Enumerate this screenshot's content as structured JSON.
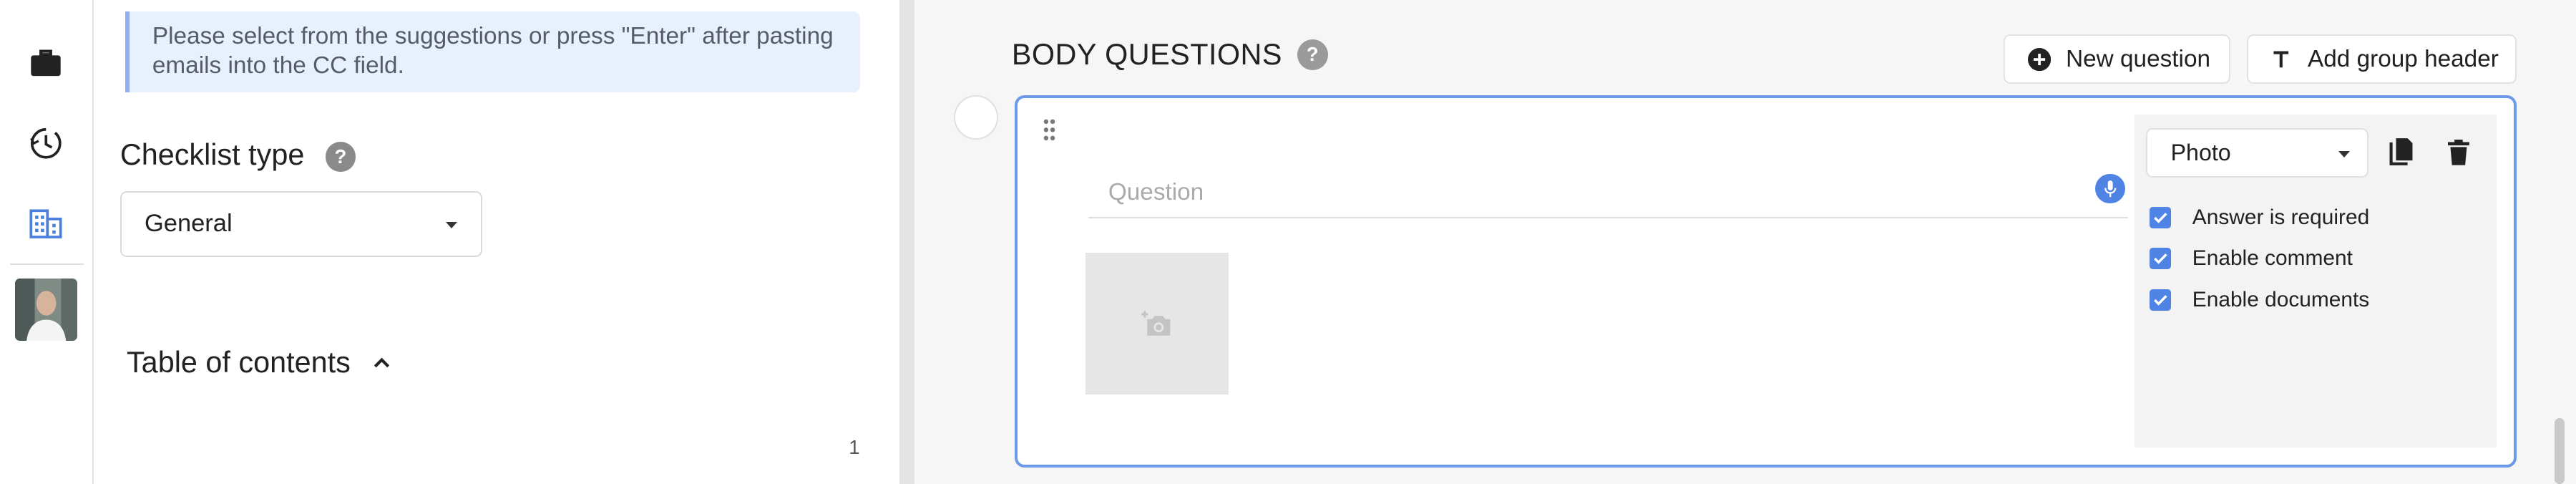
{
  "nav": {
    "icons": [
      "briefcase-icon",
      "history-icon",
      "building-icon"
    ],
    "accent_color": "#4a7fe0"
  },
  "settings": {
    "info_text": "Please select from the suggestions or press \"Enter\" after pasting emails into the CC field.",
    "checklist_type_label": "Checklist type",
    "checklist_type_value": "General",
    "toc_label": "Table of contents",
    "page_number": "1"
  },
  "editor": {
    "title": "BODY QUESTIONS",
    "new_question_label": "New question",
    "add_group_header_label": "Add group header",
    "question": {
      "placeholder": "Question",
      "answer_type": "Photo",
      "options": [
        {
          "label": "Answer is required",
          "checked": true
        },
        {
          "label": "Enable comment",
          "checked": true
        },
        {
          "label": "Enable documents",
          "checked": true
        }
      ]
    },
    "card_border_color": "#6c9ae8",
    "checkbox_color": "#4f84e4"
  }
}
